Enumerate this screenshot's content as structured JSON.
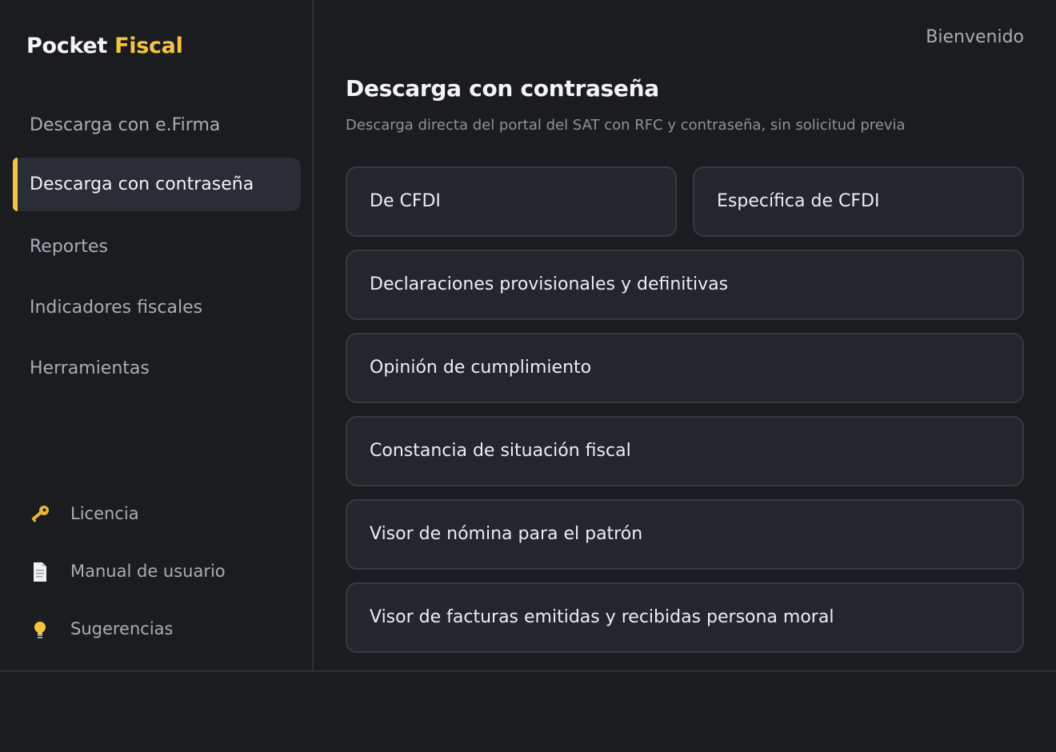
{
  "brand": {
    "name_first": "Pocket",
    "name_accent": "Fiscal"
  },
  "colors": {
    "accent": "#f5c242",
    "background": "#1b1c20",
    "card": "#23262d",
    "active_nav": "#2a2d35"
  },
  "sidebar": {
    "items": [
      {
        "label": "Descarga con e.Firma",
        "active": false
      },
      {
        "label": "Descarga con contraseña",
        "active": true
      },
      {
        "label": "Reportes",
        "active": false
      },
      {
        "label": "Indicadores fiscales",
        "active": false
      },
      {
        "label": "Herramientas",
        "active": false
      }
    ],
    "footer": [
      {
        "label": "Licencia",
        "icon": "key-icon"
      },
      {
        "label": "Manual de usuario",
        "icon": "document-icon"
      },
      {
        "label": "Sugerencias",
        "icon": "lightbulb-icon"
      }
    ]
  },
  "header": {
    "welcome": "Bienvenido"
  },
  "main": {
    "title": "Descarga con contraseña",
    "subtitle": "Descarga directa del portal del SAT con RFC y contraseña, sin solicitud previa",
    "options": [
      {
        "label": "De CFDI"
      },
      {
        "label": "Específica de CFDI"
      },
      {
        "label": "Declaraciones provisionales y definitivas"
      },
      {
        "label": "Opinión de cumplimiento"
      },
      {
        "label": "Constancia de situación fiscal"
      },
      {
        "label": "Visor de nómina para el patrón"
      },
      {
        "label": "Visor de facturas emitidas y recibidas persona moral"
      }
    ]
  }
}
